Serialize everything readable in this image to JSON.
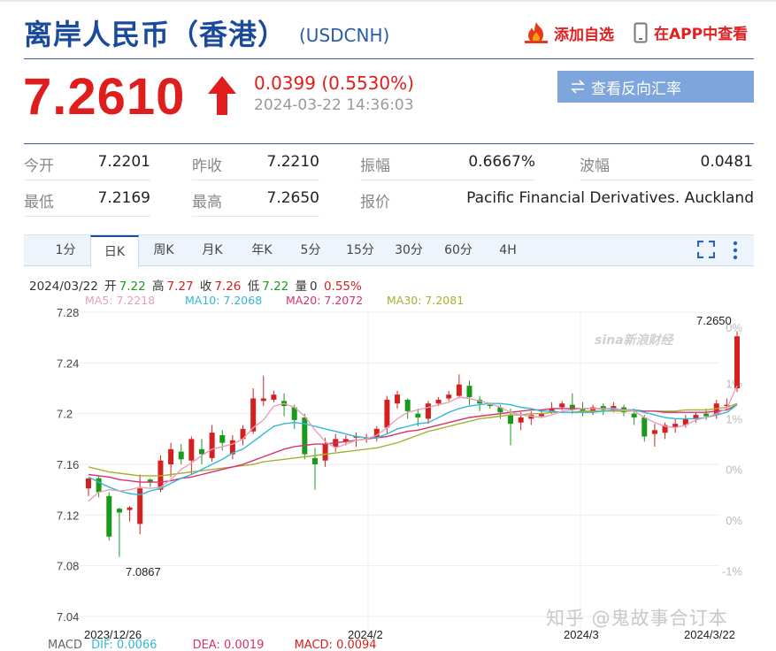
{
  "header": {
    "title": "离岸人民币（香港）",
    "symbol": "(USDCNH)",
    "favorite_label": "添加自选",
    "app_label": "在APP中查看"
  },
  "quote": {
    "price": "7.2610",
    "change": "0.0399 (0.5530%)",
    "timestamp": "2024-03-22 14:36:03",
    "reverse_button": "查看反向汇率"
  },
  "stats": {
    "open_label": "今开",
    "open": "7.2201",
    "prev_close_label": "昨收",
    "prev_close": "7.2210",
    "amplitude_label": "振幅",
    "amplitude": "0.6667%",
    "wave_label": "波幅",
    "wave": "0.0481",
    "low_label": "最低",
    "low": "7.2169",
    "high_label": "最高",
    "high": "7.2650",
    "quoter_label": "报价",
    "quoter": "Pacific Financial Derivatives. Auckland"
  },
  "tabs": [
    "1分",
    "日K",
    "周K",
    "月K",
    "年K",
    "5分",
    "15分",
    "30分",
    "60分",
    "4H"
  ],
  "active_tab": "日K",
  "info": {
    "date": "2024/03/22",
    "open_label": "开",
    "open": "7.22",
    "high_label": "高",
    "high": "7.27",
    "close_label": "收",
    "close": "7.26",
    "low_label": "低",
    "low": "7.22",
    "vol_label": "量",
    "vol": "0",
    "pct": "0.55%"
  },
  "ma": {
    "ma5": "MA5: 7.2218",
    "ma10": "MA10: 7.2068",
    "ma20": "MA20: 7.2072",
    "ma30": "MA30: 7.2081"
  },
  "colors": {
    "up": "#d52020",
    "down": "#1a9a1a",
    "ma5": "#e8a0b8",
    "ma10": "#30b8d8",
    "ma20": "#d83070",
    "ma30": "#a8b030",
    "title": "#1a4a9c"
  },
  "chart_data": {
    "type": "candlestick",
    "y_ticks": [
      "7.28",
      "7.24",
      "7.2",
      "7.16",
      "7.12",
      "7.08",
      "7.04"
    ],
    "y_ticks_right": [
      "0%",
      "1%",
      "1%",
      "0%",
      "0%",
      "-1%"
    ],
    "ylim": [
      7.04,
      7.28
    ],
    "x_labels": [
      "2023/12/26",
      "2024/2",
      "2024/3",
      "2024/3/22"
    ],
    "high_annotation": "7.2650",
    "low_annotation": "7.0867",
    "candles": [
      [
        7.141,
        7.149,
        7.135,
        7.149
      ],
      [
        7.149,
        7.138,
        7.134,
        7.151
      ],
      [
        7.135,
        7.103,
        7.1,
        7.138
      ],
      [
        7.125,
        7.122,
        7.087,
        7.126
      ],
      [
        7.124,
        7.126,
        7.115,
        7.127
      ],
      [
        7.113,
        7.141,
        7.105,
        7.152
      ],
      [
        7.148,
        7.146,
        7.142,
        7.149
      ],
      [
        7.14,
        7.163,
        7.138,
        7.167
      ],
      [
        7.16,
        7.172,
        7.15,
        7.177
      ],
      [
        7.17,
        7.164,
        7.16,
        7.176
      ],
      [
        7.163,
        7.18,
        7.152,
        7.182
      ],
      [
        7.172,
        7.168,
        7.16,
        7.18
      ],
      [
        7.165,
        7.185,
        7.162,
        7.191
      ],
      [
        7.183,
        7.177,
        7.171,
        7.187
      ],
      [
        7.168,
        7.179,
        7.164,
        7.183
      ],
      [
        7.18,
        7.188,
        7.175,
        7.191
      ],
      [
        7.186,
        7.212,
        7.184,
        7.22
      ],
      [
        7.21,
        7.212,
        7.206,
        7.23
      ],
      [
        7.211,
        7.215,
        7.209,
        7.218
      ],
      [
        7.21,
        7.206,
        7.198,
        7.216
      ],
      [
        7.205,
        7.195,
        7.188,
        7.207
      ],
      [
        7.197,
        7.168,
        7.164,
        7.2
      ],
      [
        7.165,
        7.16,
        7.14,
        7.173
      ],
      [
        7.163,
        7.176,
        7.158,
        7.181
      ],
      [
        7.174,
        7.18,
        7.17,
        7.184
      ],
      [
        7.178,
        7.18,
        7.175,
        7.183
      ],
      [
        7.181,
        7.182,
        7.174,
        7.185
      ],
      [
        7.18,
        7.181,
        7.177,
        7.184
      ],
      [
        7.181,
        7.188,
        7.178,
        7.19
      ],
      [
        7.189,
        7.211,
        7.184,
        7.214
      ],
      [
        7.208,
        7.215,
        7.204,
        7.218
      ],
      [
        7.211,
        7.202,
        7.196,
        7.212
      ],
      [
        7.2,
        7.197,
        7.19,
        7.204
      ],
      [
        7.196,
        7.208,
        7.192,
        7.21
      ],
      [
        7.208,
        7.211,
        7.206,
        7.213
      ],
      [
        7.212,
        7.215,
        7.21,
        7.218
      ],
      [
        7.214,
        7.223,
        7.212,
        7.231
      ],
      [
        7.222,
        7.213,
        7.207,
        7.226
      ],
      [
        7.211,
        7.208,
        7.202,
        7.214
      ],
      [
        7.207,
        7.206,
        7.204,
        7.209
      ],
      [
        7.205,
        7.201,
        7.196,
        7.207
      ],
      [
        7.199,
        7.192,
        7.175,
        7.204
      ],
      [
        7.193,
        7.197,
        7.187,
        7.201
      ],
      [
        7.196,
        7.199,
        7.191,
        7.202
      ],
      [
        7.198,
        7.2,
        7.197,
        7.203
      ],
      [
        7.201,
        7.204,
        7.2,
        7.209
      ],
      [
        7.205,
        7.208,
        7.203,
        7.21
      ],
      [
        7.207,
        7.203,
        7.2,
        7.216
      ],
      [
        7.204,
        7.202,
        7.198,
        7.209
      ],
      [
        7.201,
        7.205,
        7.199,
        7.207
      ],
      [
        7.206,
        7.203,
        7.199,
        7.208
      ],
      [
        7.203,
        7.206,
        7.201,
        7.209
      ],
      [
        7.205,
        7.201,
        7.198,
        7.207
      ],
      [
        7.2,
        7.197,
        7.191,
        7.204
      ],
      [
        7.197,
        7.182,
        7.178,
        7.199
      ],
      [
        7.184,
        7.187,
        7.174,
        7.192
      ],
      [
        7.185,
        7.191,
        7.18,
        7.193
      ],
      [
        7.189,
        7.192,
        7.185,
        7.196
      ],
      [
        7.191,
        7.196,
        7.189,
        7.199
      ],
      [
        7.196,
        7.199,
        7.193,
        7.201
      ],
      [
        7.2,
        7.198,
        7.195,
        7.204
      ],
      [
        7.199,
        7.208,
        7.196,
        7.211
      ],
      [
        7.206,
        7.207,
        7.203,
        7.212
      ],
      [
        7.22,
        7.261,
        7.217,
        7.265
      ]
    ],
    "ma5": [
      7.131,
      7.138,
      7.14,
      7.139,
      7.14,
      7.142,
      7.141,
      7.142,
      7.148,
      7.156,
      7.161,
      7.167,
      7.172,
      7.174,
      7.176,
      7.18,
      7.189,
      7.195,
      7.206,
      7.208,
      7.205,
      7.198,
      7.187,
      7.178,
      7.173,
      7.176,
      7.179,
      7.18,
      7.183,
      7.189,
      7.196,
      7.201,
      7.203,
      7.205,
      7.207,
      7.209,
      7.213,
      7.212,
      7.21,
      7.208,
      7.205,
      7.201,
      7.199,
      7.198,
      7.197,
      7.199,
      7.202,
      7.203,
      7.204,
      7.204,
      7.204,
      7.204,
      7.203,
      7.202,
      7.197,
      7.193,
      7.19,
      7.189,
      7.191,
      7.195,
      7.197,
      7.2,
      7.204,
      7.222
    ],
    "ma10": [
      7.15,
      7.146,
      7.142,
      7.139,
      7.137,
      7.136,
      7.139,
      7.141,
      7.145,
      7.149,
      7.152,
      7.156,
      7.16,
      7.164,
      7.169,
      7.172,
      7.178,
      7.184,
      7.19,
      7.192,
      7.193,
      7.192,
      7.19,
      7.188,
      7.186,
      7.184,
      7.182,
      7.181,
      7.181,
      7.184,
      7.188,
      7.19,
      7.192,
      7.193,
      7.197,
      7.201,
      7.204,
      7.206,
      7.207,
      7.208,
      7.208,
      7.207,
      7.205,
      7.204,
      7.202,
      7.202,
      7.201,
      7.201,
      7.201,
      7.201,
      7.202,
      7.203,
      7.203,
      7.203,
      7.201,
      7.199,
      7.197,
      7.196,
      7.196,
      7.196,
      7.197,
      7.199,
      7.201,
      7.207
    ],
    "ma20": [
      7.152,
      7.151,
      7.15,
      7.148,
      7.147,
      7.146,
      7.146,
      7.146,
      7.147,
      7.149,
      7.15,
      7.152,
      7.154,
      7.156,
      7.158,
      7.16,
      7.163,
      7.166,
      7.169,
      7.172,
      7.174,
      7.175,
      7.176,
      7.176,
      7.177,
      7.178,
      7.179,
      7.18,
      7.181,
      7.182,
      7.184,
      7.186,
      7.187,
      7.189,
      7.191,
      7.193,
      7.195,
      7.197,
      7.198,
      7.199,
      7.2,
      7.201,
      7.202,
      7.203,
      7.203,
      7.204,
      7.204,
      7.204,
      7.204,
      7.204,
      7.204,
      7.204,
      7.203,
      7.203,
      7.202,
      7.202,
      7.201,
      7.201,
      7.201,
      7.201,
      7.201,
      7.202,
      7.203,
      7.207
    ],
    "ma30": [
      7.158,
      7.156,
      7.154,
      7.153,
      7.152,
      7.151,
      7.151,
      7.151,
      7.152,
      7.153,
      7.154,
      7.155,
      7.156,
      7.157,
      7.158,
      7.159,
      7.16,
      7.162,
      7.163,
      7.164,
      7.165,
      7.166,
      7.167,
      7.168,
      7.169,
      7.17,
      7.171,
      7.172,
      7.173,
      7.175,
      7.177,
      7.18,
      7.183,
      7.186,
      7.188,
      7.19,
      7.192,
      7.194,
      7.196,
      7.197,
      7.198,
      7.199,
      7.199,
      7.2,
      7.2,
      7.201,
      7.201,
      7.201,
      7.202,
      7.202,
      7.202,
      7.202,
      7.202,
      7.202,
      7.202,
      7.202,
      7.202,
      7.202,
      7.203,
      7.203,
      7.203,
      7.204,
      7.205,
      7.208
    ]
  },
  "watermark": "知乎 @鬼故事合订本",
  "macd": {
    "label": "MACD",
    "dif": "DIF: 0.0066",
    "dea": "DEA: 0.0019",
    "macd": "MACD: 0.0094"
  },
  "sina_logo": "sina新浪财经"
}
